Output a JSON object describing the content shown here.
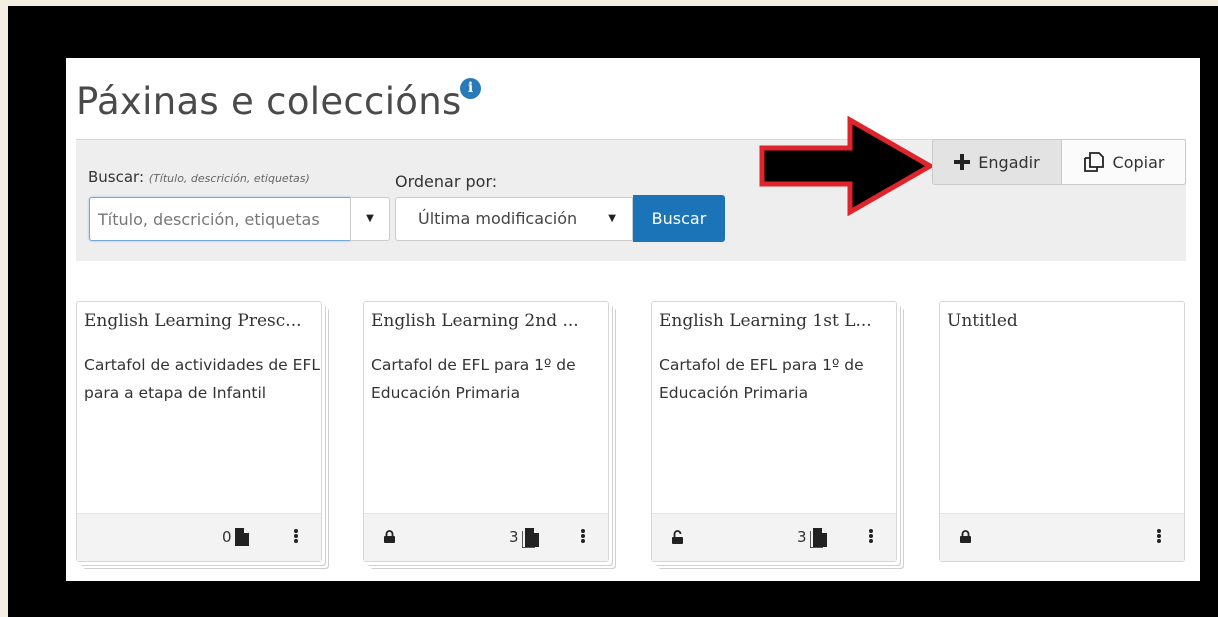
{
  "page": {
    "title": "Páxinas e coleccións",
    "info_icon": "info-icon"
  },
  "search": {
    "label": "Buscar:",
    "hint": "(Título, descrición, etiquetas)",
    "placeholder": "Título, descrición, etiquetas",
    "dropdown_icon": "caret-down-icon"
  },
  "order": {
    "label": "Ordenar por:",
    "selected": "Última modificación"
  },
  "buttons": {
    "search": "Buscar",
    "add": "Engadir",
    "copy": "Copiar"
  },
  "colors": {
    "primary": "#1b73b8",
    "arrow_fill": "#000000",
    "arrow_outline": "#e0242b"
  },
  "cards": [
    {
      "title": "English Learning Presc...",
      "description": "Cartafol de actividades de EFL para a etapa de Infantil",
      "count": "0",
      "locked": false,
      "lock_icon": "",
      "stacked": true
    },
    {
      "title": "English Learning 2nd ...",
      "description": "Cartafol de EFL para 1º de Educación Primaria",
      "count": "3",
      "locked": true,
      "lock_icon": "lock-icon",
      "stacked": true
    },
    {
      "title": "English Learning 1st L...",
      "description": "Cartafol de EFL para 1º de Educación Primaria",
      "count": "3",
      "locked": false,
      "lock_icon": "unlock-icon",
      "stacked": true
    },
    {
      "title": "Untitled",
      "description": "",
      "count": "",
      "locked": true,
      "lock_icon": "lock-icon",
      "stacked": false
    }
  ]
}
